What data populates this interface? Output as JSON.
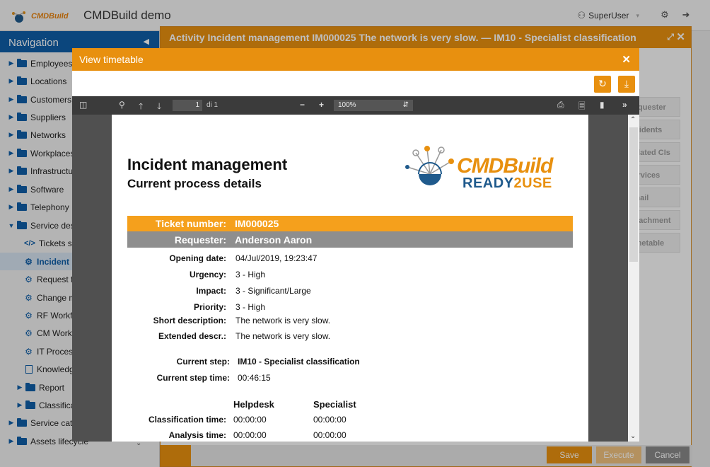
{
  "app": {
    "logo_text": "CMDBuild",
    "title": "CMDBuild demo",
    "user": "SuperUser"
  },
  "nav": {
    "header": "Navigation",
    "items": [
      {
        "label": "Employees",
        "type": "folder",
        "caret": "▶"
      },
      {
        "label": "Locations",
        "type": "folder",
        "caret": "▶"
      },
      {
        "label": "Customers",
        "type": "folder",
        "caret": "▶"
      },
      {
        "label": "Suppliers",
        "type": "folder",
        "caret": "▶"
      },
      {
        "label": "Networks",
        "type": "folder",
        "caret": "▶"
      },
      {
        "label": "Workplaces",
        "type": "folder",
        "caret": "▶"
      },
      {
        "label": "Infrastructure",
        "type": "folder",
        "caret": "▶"
      },
      {
        "label": "Software",
        "type": "folder",
        "caret": "▶"
      },
      {
        "label": "Telephony",
        "type": "folder",
        "caret": "▶"
      },
      {
        "label": "Service desk",
        "type": "folder",
        "caret": "▼"
      },
      {
        "label": "Tickets summary",
        "type": "code"
      },
      {
        "label": "Incident management",
        "type": "gear",
        "active": true
      },
      {
        "label": "Request fulfilment",
        "type": "gear"
      },
      {
        "label": "Change management",
        "type": "gear"
      },
      {
        "label": "RF Workflow",
        "type": "gear"
      },
      {
        "label": "CM Workflow",
        "type": "gear"
      },
      {
        "label": "IT Process",
        "type": "gear"
      },
      {
        "label": "Knowledge base",
        "type": "doc"
      },
      {
        "label": "Report",
        "type": "folder",
        "caret": "▶"
      },
      {
        "label": "Classification",
        "type": "folder",
        "caret": "▶"
      },
      {
        "label": "Service catalogue",
        "type": "folder",
        "caret": "▶"
      },
      {
        "label": "Assets lifecycle",
        "type": "folder",
        "caret": "▶"
      }
    ]
  },
  "activity": {
    "title": "Activity Incident management IM000025 The network is very slow. — IM10 - Specialist classification",
    "tabs": [
      "Requester",
      "Incidents",
      "Related CIs",
      "Services",
      "Email",
      "Attachment",
      "Timetable"
    ],
    "buttons": {
      "save": "Save",
      "execute": "Execute",
      "cancel": "Cancel"
    }
  },
  "modal": {
    "title": "View timetable",
    "pdf": {
      "page": "1",
      "page_of": "di 1",
      "zoom": "100%"
    }
  },
  "document": {
    "title": "Incident management",
    "subtitle": "Current process details",
    "brand_main": "CMDBuild",
    "brand_sub_1": "READY",
    "brand_sub_2": "2USE",
    "ticket_label": "Ticket number:",
    "ticket_value": "IM000025",
    "requester_label": "Requester:",
    "requester_value": "Anderson Aaron",
    "fields": [
      {
        "label": "Opening date:",
        "value": "04/Jul/2019, 19:23:47"
      },
      {
        "label": "Urgency:",
        "value": "3 - High"
      },
      {
        "label": "Impact:",
        "value": "3 - Significant/Large"
      },
      {
        "label": "Priority:",
        "value": "3 - High"
      },
      {
        "label": "Short description:",
        "value": "The network is very slow."
      },
      {
        "label": "Extended descr.:",
        "value": "The network is very slow."
      }
    ],
    "current_step_label": "Current step:",
    "current_step_value": "IM10 - Specialist classification",
    "current_step_time_label": "Current step time:",
    "current_step_time_value": "00:46:15",
    "times_header": [
      "Helpdesk",
      "Specialist"
    ],
    "times": [
      {
        "label": "Classification time:",
        "helpdesk": "00:00:00",
        "specialist": "00:00:00"
      },
      {
        "label": "Analysis time:",
        "helpdesk": "00:00:00",
        "specialist": "00:00:00"
      }
    ]
  }
}
